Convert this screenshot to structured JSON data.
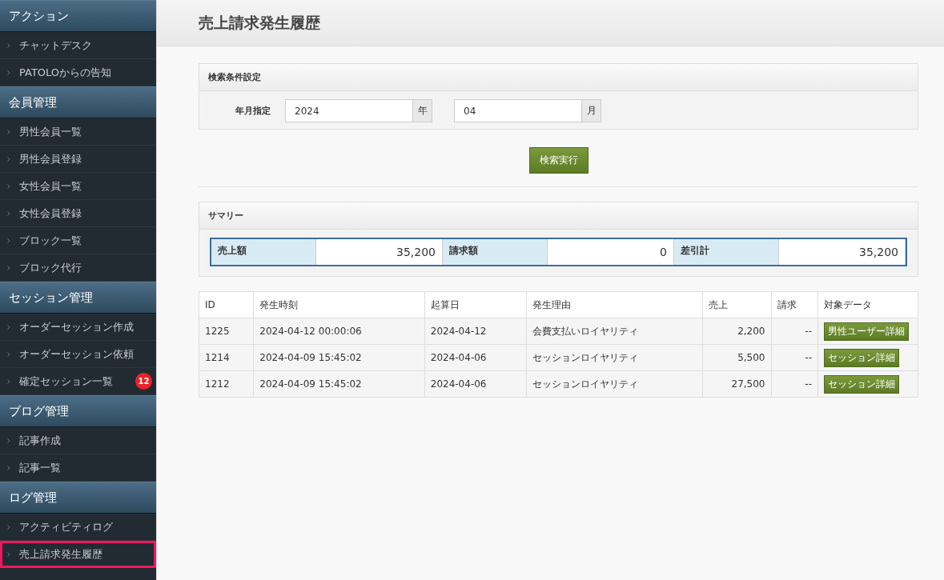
{
  "sidebar": {
    "groups": [
      {
        "title": "アクション",
        "items": [
          {
            "label": "チャットデスク",
            "selected": false
          },
          {
            "label": "PATOLOからの告知",
            "selected": false
          }
        ]
      },
      {
        "title": "会員管理",
        "items": [
          {
            "label": "男性会員一覧",
            "selected": false
          },
          {
            "label": "男性会員登録",
            "selected": false
          },
          {
            "label": "女性会員一覧",
            "selected": false
          },
          {
            "label": "女性会員登録",
            "selected": false
          },
          {
            "label": "ブロック一覧",
            "selected": false
          },
          {
            "label": "ブロック代行",
            "selected": false
          }
        ]
      },
      {
        "title": "セッション管理",
        "items": [
          {
            "label": "オーダーセッション作成",
            "selected": false
          },
          {
            "label": "オーダーセッション依頼",
            "selected": false
          },
          {
            "label": "確定セッション一覧",
            "selected": false,
            "badge": "12"
          }
        ]
      },
      {
        "title": "ブログ管理",
        "items": [
          {
            "label": "記事作成",
            "selected": false
          },
          {
            "label": "記事一覧",
            "selected": false
          }
        ]
      },
      {
        "title": "ログ管理",
        "items": [
          {
            "label": "アクティビティログ",
            "selected": false
          },
          {
            "label": "売上請求発生履歴",
            "selected": true
          }
        ]
      }
    ]
  },
  "page_title": "売上請求発生履歴",
  "search": {
    "title": "検索条件設定",
    "label": "年月指定",
    "year": {
      "value": "2024",
      "unit": "年"
    },
    "month": {
      "value": "04",
      "unit": "月"
    },
    "button": "検索実行"
  },
  "summary": {
    "title": "サマリー",
    "cells": [
      {
        "label": "売上額",
        "value": "35,200"
      },
      {
        "label": "請求額",
        "value": "0"
      },
      {
        "label": "差引計",
        "value": "35,200"
      }
    ]
  },
  "table": {
    "columns": [
      "ID",
      "発生時刻",
      "起算日",
      "発生理由",
      "売上",
      "請求",
      "対象データ"
    ],
    "rows": [
      {
        "id": "1225",
        "time": "2024-04-12 00:00:06",
        "date": "2024-04-12",
        "reason": "会費支払いロイヤリティ",
        "sales": "2,200",
        "billing": "--",
        "action": "男性ユーザー詳細"
      },
      {
        "id": "1214",
        "time": "2024-04-09 15:45:02",
        "date": "2024-04-06",
        "reason": "セッションロイヤリティ",
        "sales": "5,500",
        "billing": "--",
        "action": "セッション詳細"
      },
      {
        "id": "1212",
        "time": "2024-04-09 15:45:02",
        "date": "2024-04-06",
        "reason": "セッションロイヤリティ",
        "sales": "27,500",
        "billing": "--",
        "action": "セッション詳細"
      }
    ]
  }
}
